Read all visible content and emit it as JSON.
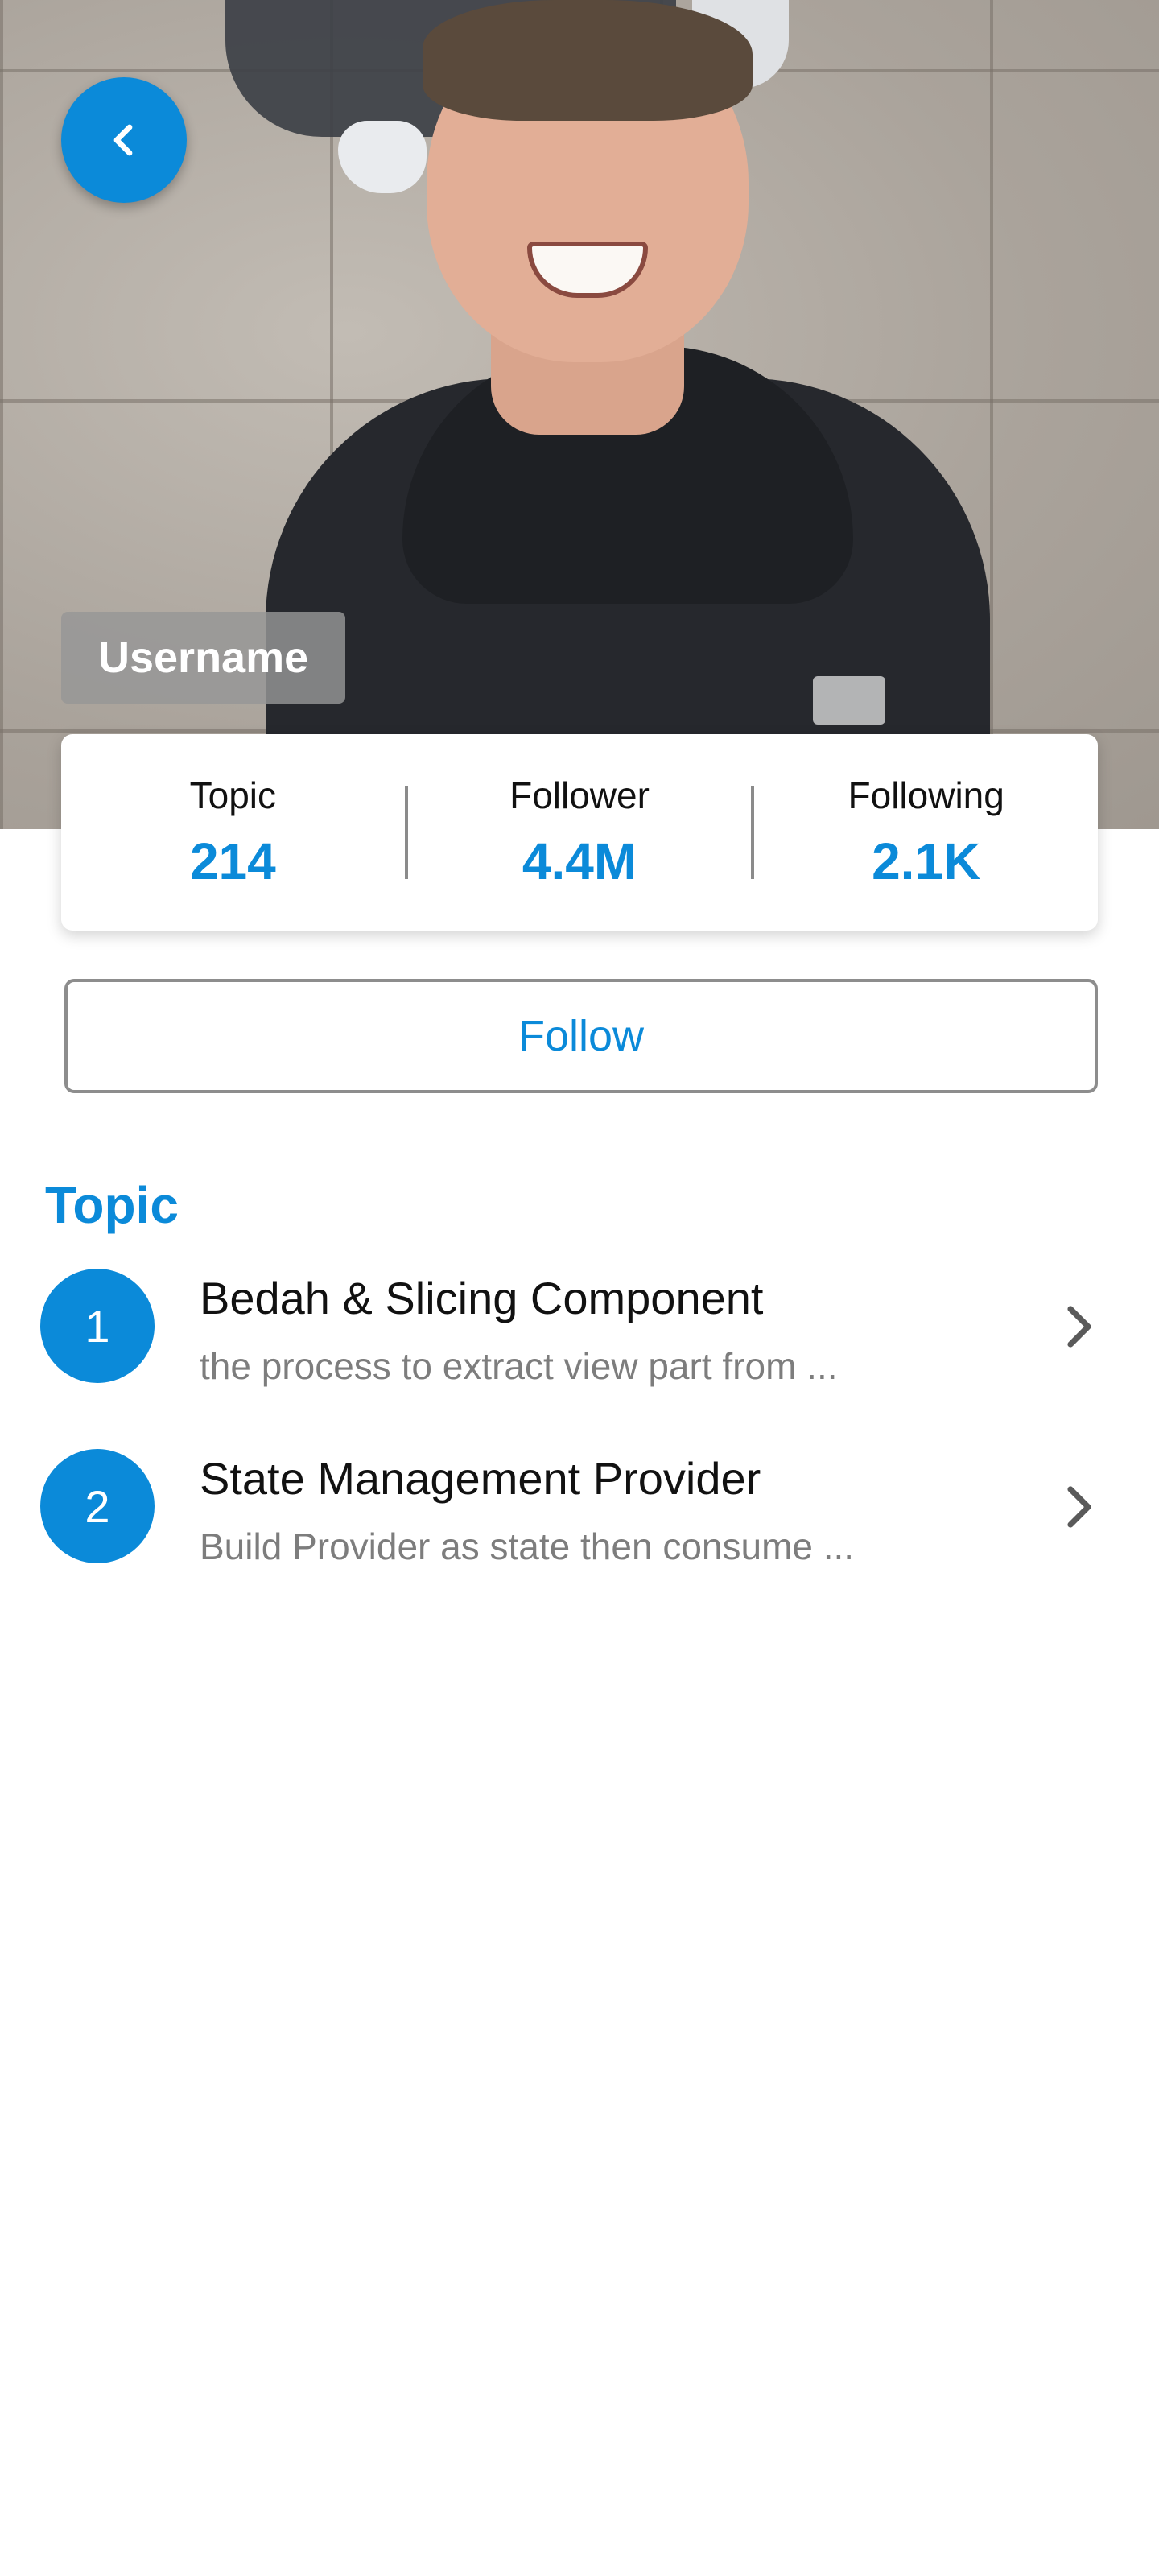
{
  "profile": {
    "username": "Username"
  },
  "stats": [
    {
      "label": "Topic",
      "value": "214"
    },
    {
      "label": "Follower",
      "value": "4.4M"
    },
    {
      "label": "Following",
      "value": "2.1K"
    }
  ],
  "actions": {
    "follow_label": "Follow"
  },
  "topics": {
    "section_title": "Topic",
    "items": [
      {
        "number": "1",
        "title": "Bedah & Slicing Component",
        "description": "the process to extract view part from ..."
      },
      {
        "number": "2",
        "title": "State Management Provider",
        "description": "Build Provider as state then consume ..."
      }
    ]
  },
  "icons": {
    "back": "chevron-left-icon",
    "item_arrow": "chevron-right-icon"
  },
  "colors": {
    "accent": "#0b8ad9",
    "badge_bg": "#969696",
    "secondary_text": "#7d7d7d"
  }
}
